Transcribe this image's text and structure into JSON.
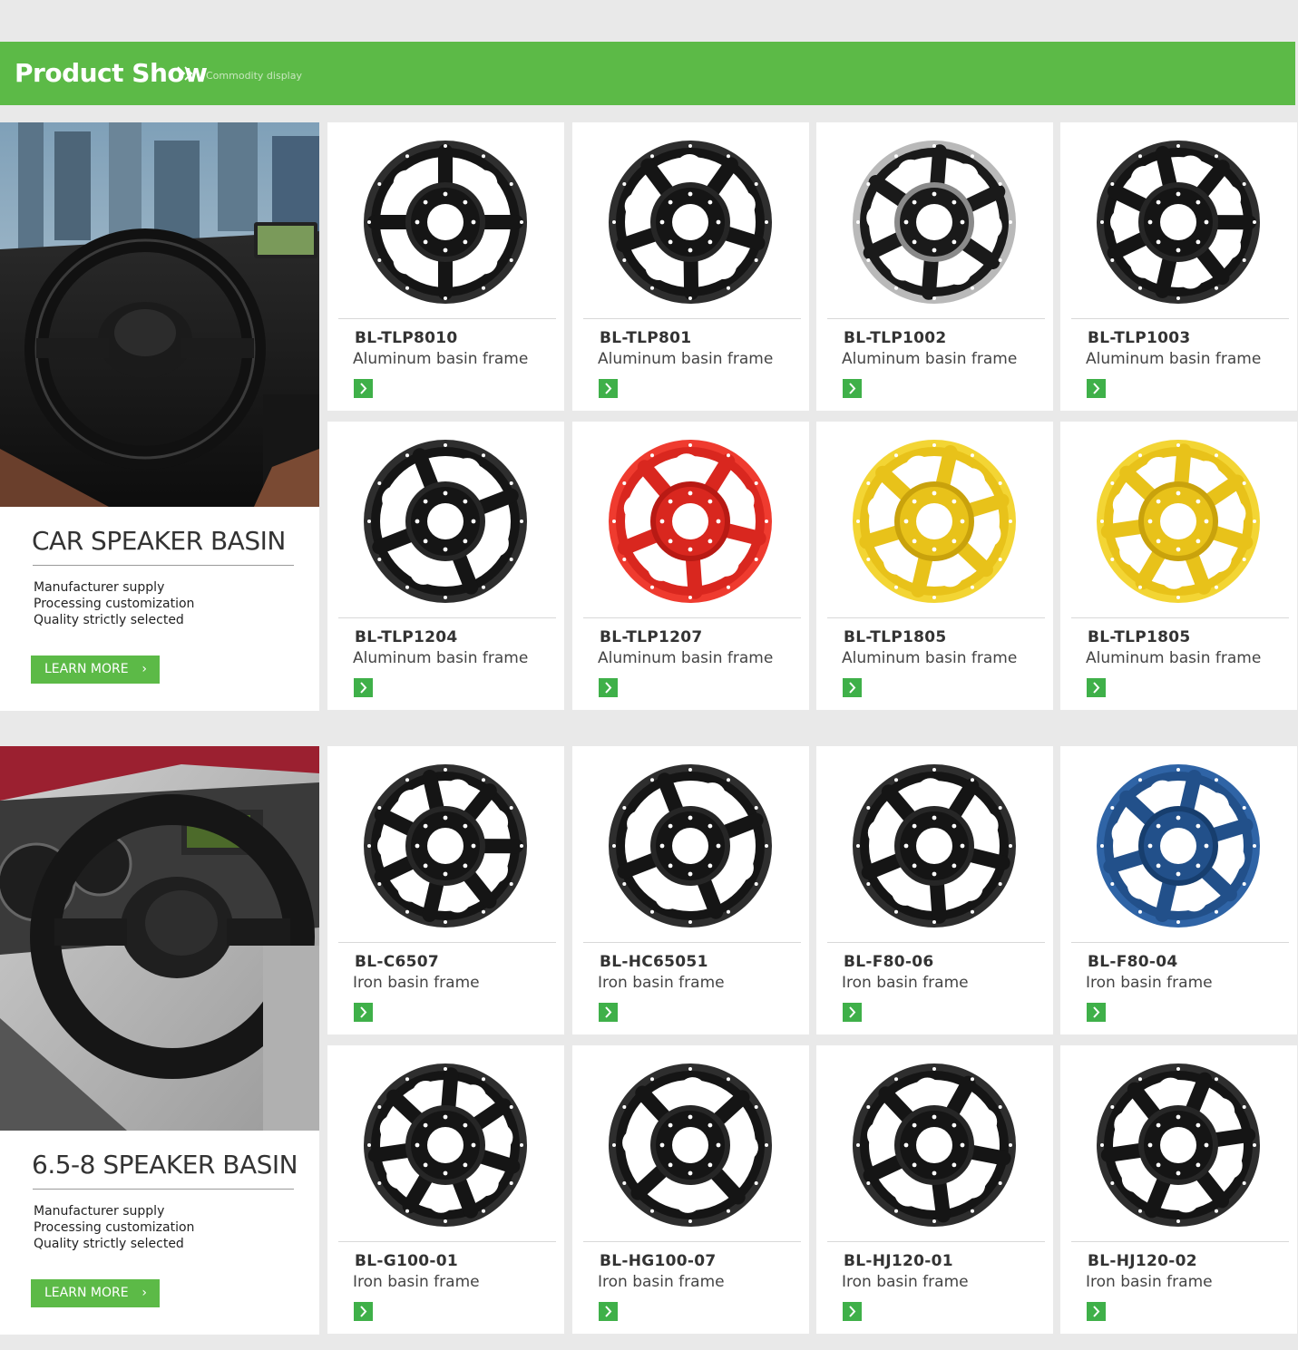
{
  "header": {
    "title": "Product Show",
    "subtitle": "Commodity display"
  },
  "colors": {
    "accent": "#5cba47",
    "button": "#3fb049"
  },
  "sections": [
    {
      "promo": {
        "title": "CAR SPEAKER BASIN",
        "bullets": [
          "Manufacturer supply",
          "Processing customization",
          "Quality strictly selected"
        ],
        "button": "LEARN MORE"
      },
      "products": [
        {
          "code": "BL-TLP8010",
          "desc": "Aluminum basin frame",
          "color": "black"
        },
        {
          "code": "BL-TLP801",
          "desc": "Aluminum basin frame",
          "color": "black"
        },
        {
          "code": "BL-TLP1002",
          "desc": "Aluminum basin frame",
          "color": "black-silver"
        },
        {
          "code": "BL-TLP1003",
          "desc": "Aluminum basin frame",
          "color": "black"
        },
        {
          "code": "BL-TLP1204",
          "desc": "Aluminum basin frame",
          "color": "black"
        },
        {
          "code": "BL-TLP1207",
          "desc": "Aluminum basin frame",
          "color": "red"
        },
        {
          "code": "BL-TLP1805",
          "desc": "Aluminum basin frame",
          "color": "yellow"
        },
        {
          "code": "BL-TLP1805",
          "desc": "Aluminum basin frame",
          "color": "yellow"
        }
      ]
    },
    {
      "promo": {
        "title": "6.5-8 SPEAKER BASIN",
        "bullets": [
          "Manufacturer supply",
          "Processing customization",
          "Quality strictly selected"
        ],
        "button": "LEARN MORE"
      },
      "products": [
        {
          "code": "BL-C6507",
          "desc": "Iron basin frame",
          "color": "black"
        },
        {
          "code": "BL-HC65051",
          "desc": "Iron basin frame",
          "color": "black"
        },
        {
          "code": "BL-F80-06",
          "desc": "Iron basin frame",
          "color": "black"
        },
        {
          "code": "BL-F80-04",
          "desc": "Iron basin frame",
          "color": "blue"
        },
        {
          "code": "BL-G100-01",
          "desc": "Iron basin frame",
          "color": "black"
        },
        {
          "code": "BL-HG100-07",
          "desc": "Iron basin frame",
          "color": "black"
        },
        {
          "code": "BL-HJ120-01",
          "desc": "Iron basin frame",
          "color": "black"
        },
        {
          "code": "BL-HJ120-02",
          "desc": "Iron basin frame",
          "color": "black"
        }
      ]
    }
  ]
}
